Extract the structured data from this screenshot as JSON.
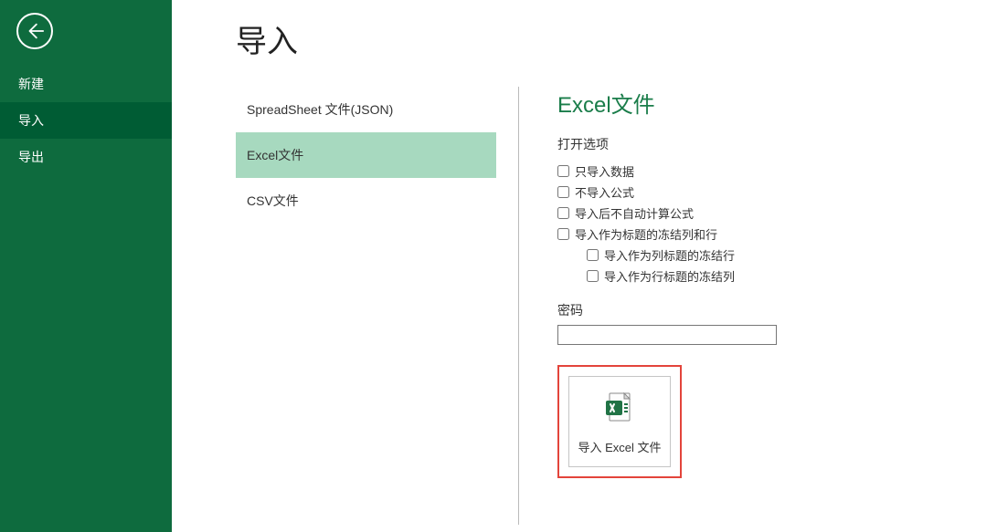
{
  "sidebar": {
    "items": [
      "新建",
      "导入",
      "导出"
    ],
    "activeIndex": 1
  },
  "page": {
    "title": "导入"
  },
  "list": {
    "items": [
      "SpreadSheet 文件(JSON)",
      "Excel文件",
      "CSV文件"
    ],
    "selectedIndex": 1
  },
  "detail": {
    "heading": "Excel文件",
    "optionsLabel": "打开选项",
    "checkboxes": {
      "onlyData": "只导入数据",
      "noFormula": "不导入公式",
      "noAutoCalc": "导入后不自动计算公式",
      "freezeHeader": "导入作为标题的冻结列和行",
      "freezeCols": "导入作为列标题的冻结行",
      "freezeRows": "导入作为行标题的冻结列"
    },
    "passwordLabel": "密码",
    "importButtonLabel": "导入 Excel 文件"
  }
}
